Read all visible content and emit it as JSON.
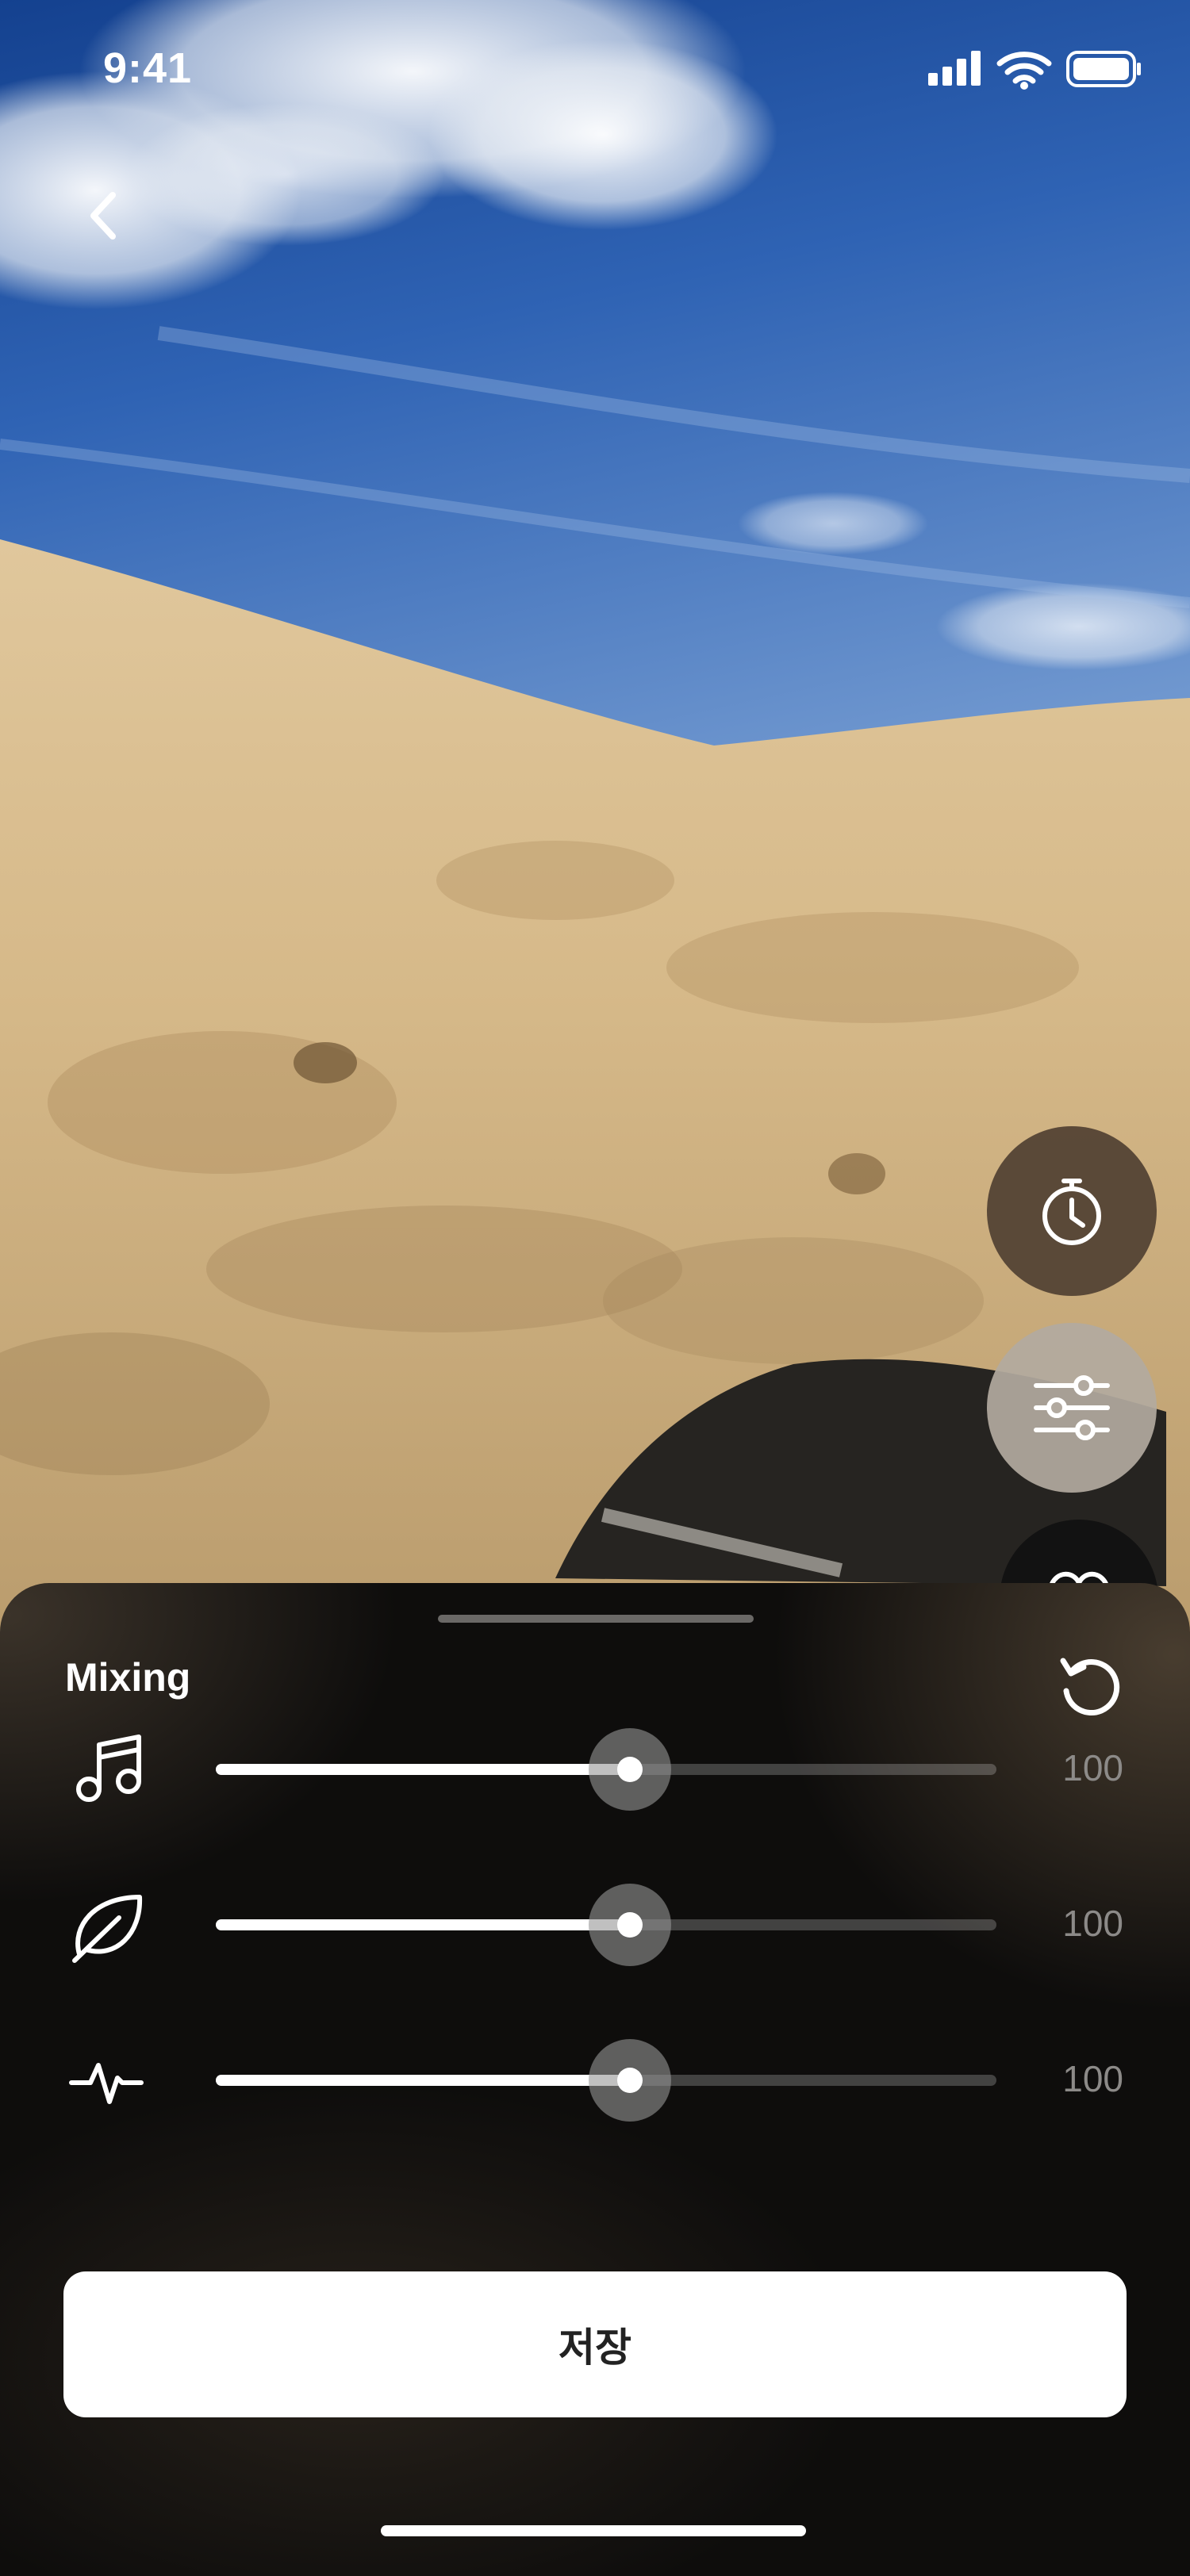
{
  "status_bar": {
    "time": "9:41",
    "icons": [
      "cellular-signal-icon",
      "wifi-icon",
      "battery-icon"
    ]
  },
  "navigation": {
    "back_icon": "chevron-left-icon"
  },
  "floating_actions": [
    {
      "name": "timer",
      "icon": "stopwatch-icon"
    },
    {
      "name": "mixing",
      "icon": "sliders-icon"
    },
    {
      "name": "favorite",
      "icon": "heart-icon"
    }
  ],
  "mixing_sheet": {
    "title": "Mixing",
    "reset_icon": "reset-icon",
    "channels": [
      {
        "icon": "music-note-icon",
        "value": "100",
        "level": 0.53
      },
      {
        "icon": "leaf-icon",
        "value": "100",
        "level": 0.53
      },
      {
        "icon": "pulse-icon",
        "value": "100",
        "level": 0.53
      }
    ],
    "save_label": "저장"
  },
  "colors": {
    "sheet_background": "#0e0d0c",
    "accent": "#ffffff",
    "value_text": "#8c8a88",
    "sky": "#2a5aa8",
    "sand": "#d4b88c"
  }
}
